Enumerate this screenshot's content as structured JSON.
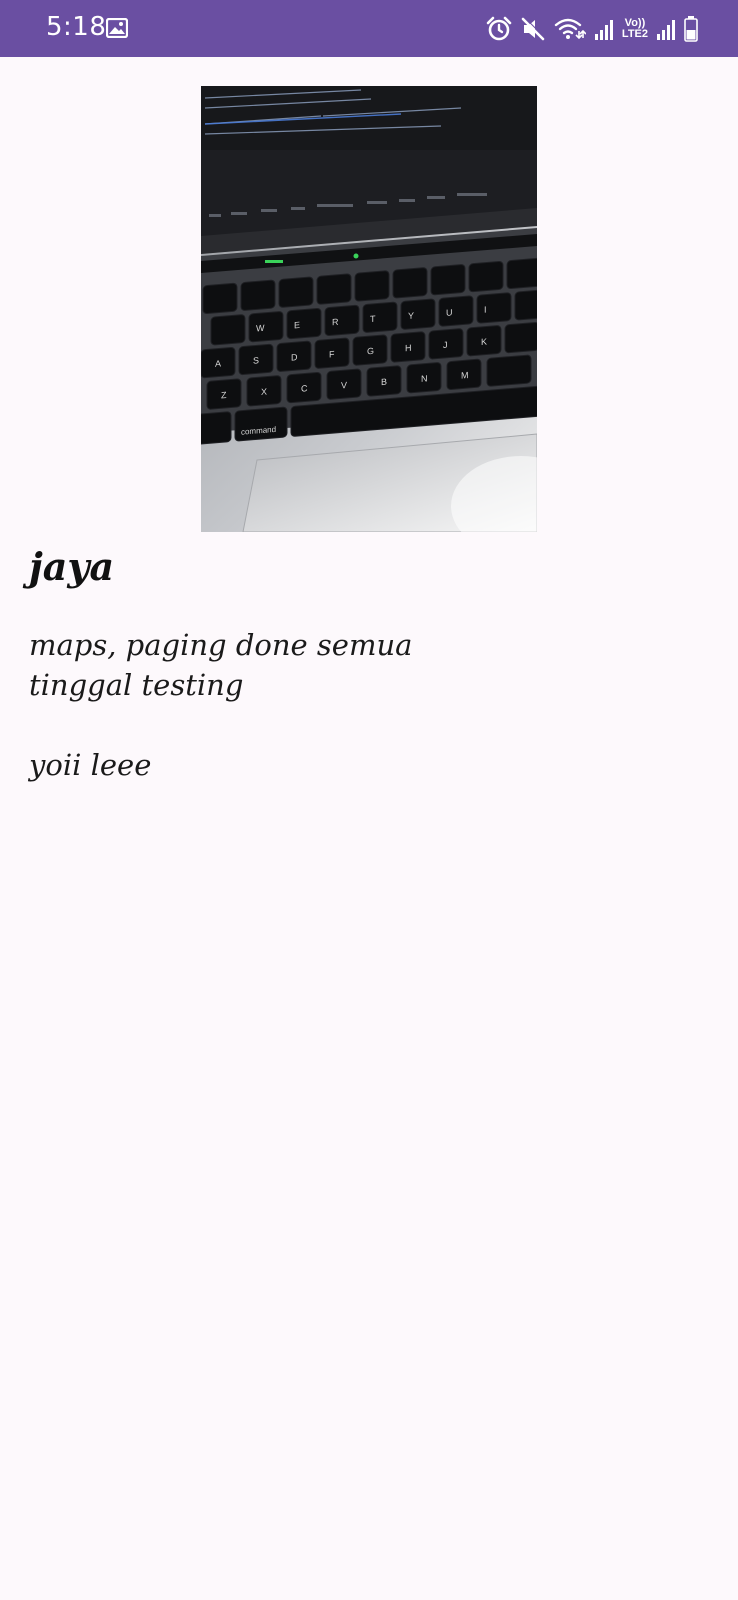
{
  "status_bar": {
    "time": "5:18",
    "volte_top": "Vo))",
    "volte_bottom": "LTE2",
    "icons": [
      "gallery-icon",
      "alarm-icon",
      "mute-icon",
      "wifi-icon",
      "signal-icon",
      "signal-icon",
      "battery-icon"
    ],
    "background_color": "#6a4fa2"
  },
  "note": {
    "title": "jaya",
    "body": "maps, paging done semua\ntinggal testing\n\nyoii leee"
  },
  "photo": {
    "label_command": "command"
  }
}
